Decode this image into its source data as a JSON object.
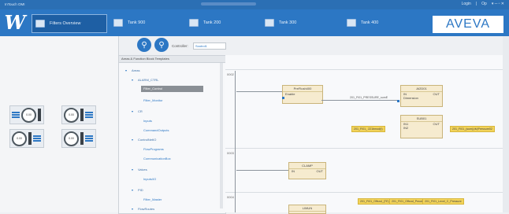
{
  "titlebar": {
    "app_title": "InTouch OMI",
    "login": "Login",
    "divider": "|",
    "user": "Op",
    "icons": "▾ ─ ▫ ✕"
  },
  "tabs": [
    {
      "label": "Filters Overview",
      "active": true
    },
    {
      "label": "Tank 900",
      "active": false
    },
    {
      "label": "Tank 200",
      "active": false
    },
    {
      "label": "Tank 300",
      "active": false
    },
    {
      "label": "Tank 400",
      "active": false
    }
  ],
  "brand": {
    "logo_letter": "W",
    "aveva": "AVEVA"
  },
  "toolbar": {
    "search_icon": "search-icon",
    "zoom_icon": "zoom-icon",
    "controller_label": "Controller:",
    "controller_value": "Sootrol1"
  },
  "tree": {
    "title": "Areas & Function Block Templates",
    "items": [
      {
        "label": "Areas",
        "level": 0
      },
      {
        "label": "ALARM_CTRL",
        "level": 1
      },
      {
        "label": "Filter_Control",
        "level": 2,
        "selected": true
      },
      {
        "label": "Filter_Monitor",
        "level": 2
      },
      {
        "label": "CR",
        "level": 1
      },
      {
        "label": "Inputs",
        "level": 2
      },
      {
        "label": "CommandOutputs",
        "level": 2
      },
      {
        "label": "ControlNetIO",
        "level": 1
      },
      {
        "label": "FlowPrograms",
        "level": 2
      },
      {
        "label": "CommunicationBox",
        "level": 2
      },
      {
        "label": "Valves",
        "level": 1
      },
      {
        "label": "Inputs/IO",
        "level": 2
      },
      {
        "label": "PID",
        "level": 1
      },
      {
        "label": "Filter_Master",
        "level": 2
      },
      {
        "label": "FlowRoutes",
        "level": 1
      }
    ]
  },
  "diagram": {
    "lanes": [
      "0002",
      "0003",
      "0004"
    ],
    "blocks": [
      {
        "title": "PreFlush400",
        "row1_left": "Enable",
        "row1_right": ""
      },
      {
        "title": "AI2D01",
        "row1_left": "IN",
        "row1_right": "OUT",
        "row2_left": "Dimension",
        "row2_right": ""
      },
      {
        "title": "SUB01",
        "row1_left": "IN1",
        "row1_right": "OUT",
        "row2_left": "IN2",
        "row2_right": ""
      },
      {
        "title": "CLAMP",
        "row1_left": "IN",
        "row1_right": "OUT"
      },
      {
        "title": "LIMUN",
        "row1_left": "",
        "row1_right": ""
      }
    ],
    "wire_texts": [
      "201_FI01_PRESSURE_sumE",
      "201_FI01_(sum)(dv)Pressure01"
    ],
    "tags": [
      "201_FI01_ 221bmod(t)",
      "201_FI01_(sum)(dv)Pressure02",
      "201_FI01_Offsnd_(TE)(dv)Pressure",
      "201_FI01_Offsnd_Pmod_wait",
      "201_FI01_Level_C_Pressure"
    ]
  },
  "left_devices": [
    {
      "gauge": "0.00"
    },
    {
      "gauge": "0.00"
    },
    {
      "gauge": "0.00"
    },
    {
      "gauge": "0.00"
    }
  ]
}
